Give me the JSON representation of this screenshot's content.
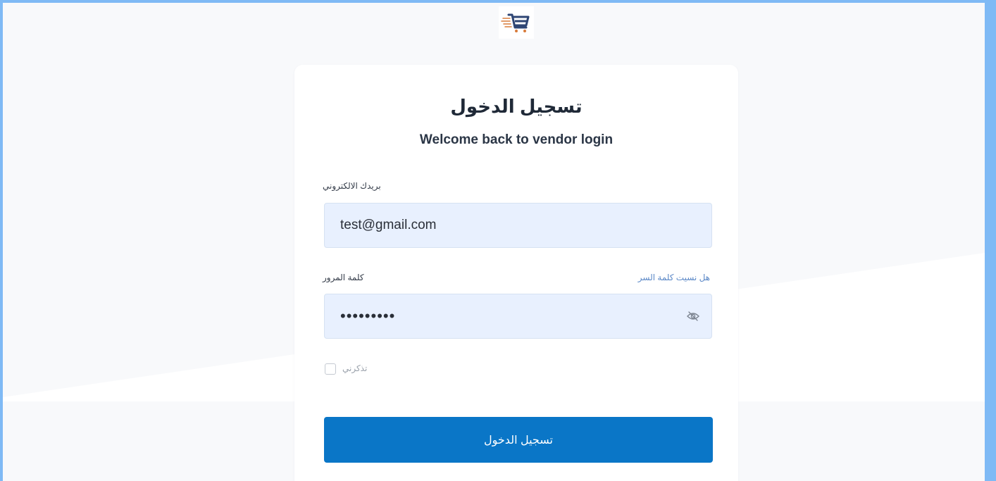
{
  "login": {
    "title": "تسجيل الدخول",
    "subtitle": "Welcome back to vendor login",
    "email": {
      "label": "بريدك الالكتروني",
      "value": "test@gmail.com"
    },
    "password": {
      "label": "كلمة المرور",
      "value": "123456789",
      "forgot_label": "هل نسيت كلمة السر",
      "toggle_icon": "eye-slash-icon"
    },
    "remember": {
      "label": "تذكرني",
      "checked": false
    },
    "submit_label": "تسجيل الدخول"
  },
  "logo": {
    "icon": "shopping-cart-icon"
  },
  "colors": {
    "accent": "#0a76c7",
    "input_background": "#e8f0fe",
    "link": "#5b88c7",
    "frame_border": "#7fbaf5"
  }
}
